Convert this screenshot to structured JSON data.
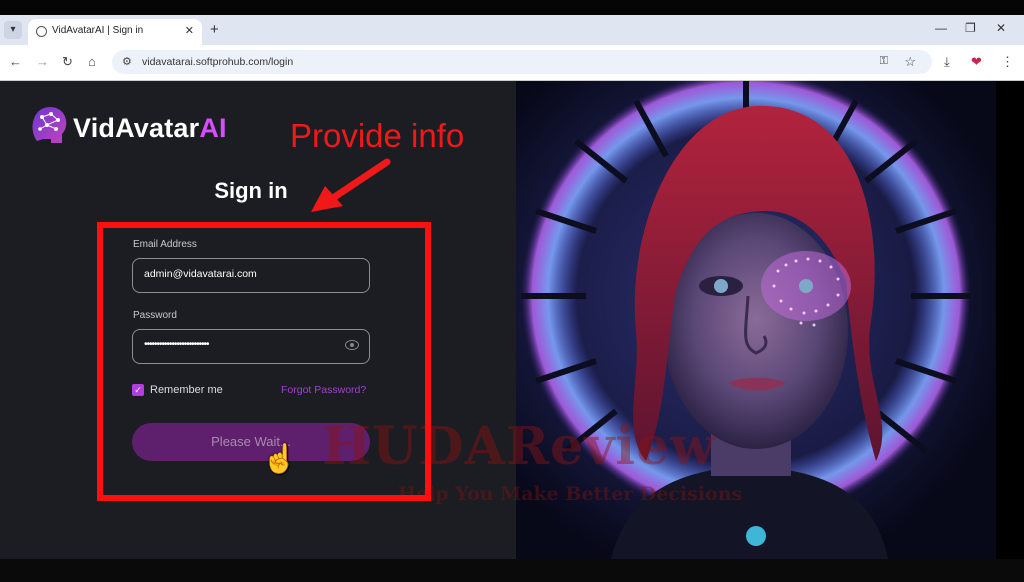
{
  "browser": {
    "tab_title": "VidAvatarAI | Sign in",
    "url": "vidavatarai.softprohub.com/login"
  },
  "logo": {
    "name_main": "VidAvatar",
    "name_ai": "AI"
  },
  "heading": "Sign in",
  "form": {
    "email_label": "Email Address",
    "email_value": "admin@vidavatarai.com",
    "password_label": "Password",
    "password_value": "••••••••••••••••••••••••••",
    "remember_label": "Remember me",
    "remember_checked": true,
    "forgot_label": "Forgot Password?",
    "submit_label": "Please Wait..."
  },
  "annotation": {
    "text": "Provide info",
    "color": "#f01818"
  },
  "watermark": {
    "title": "HUDAReview",
    "subtitle": "Help You Make Better Decisions"
  },
  "icons": [
    "tab-list-icon",
    "globe-icon",
    "close-icon",
    "plus-icon",
    "minimize-icon",
    "restore-icon",
    "back-icon",
    "forward-icon",
    "reload-icon",
    "home-icon",
    "site-info-icon",
    "key-icon",
    "star-icon",
    "download-icon",
    "extension-icon",
    "menu-icon",
    "brain-icon",
    "eye-icon",
    "check-icon",
    "hand-cursor-icon"
  ],
  "colors": {
    "accent": "#b23de0",
    "background": "#1c1d22",
    "button": "#5e1f6d"
  }
}
